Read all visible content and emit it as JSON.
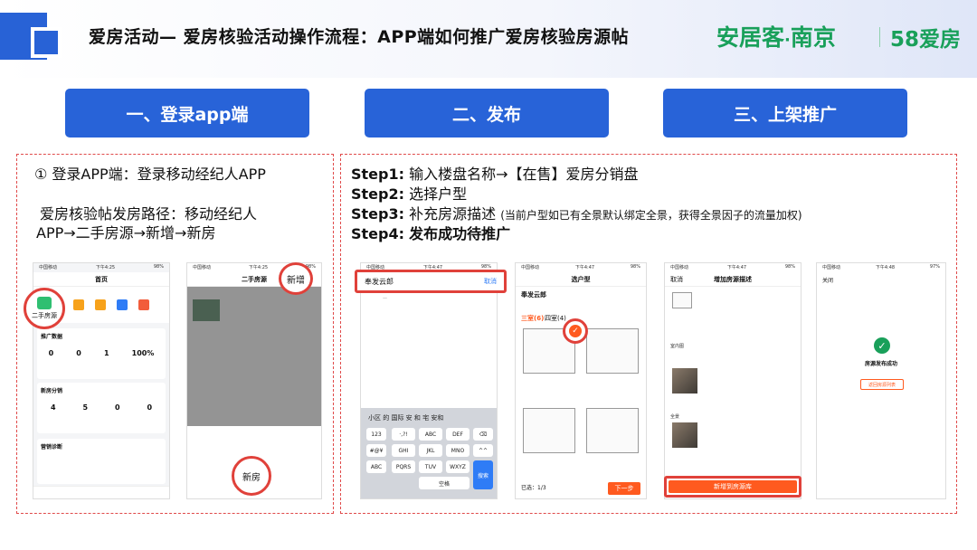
{
  "header": {
    "title": "爱房活动— 爱房核验活动操作流程：APP端如何推广爱房核验房源帖",
    "brand_main": "安居客",
    "brand_city": "南京",
    "brand_58": "58爱房"
  },
  "steps": [
    {
      "label": "一、登录app端"
    },
    {
      "label": "二、发布"
    },
    {
      "label": "三、上架推广"
    }
  ],
  "left_panel": {
    "line1": "① 登录APP端：登录移动经纪人APP",
    "line2": "爱房核验帖发房路径：移动经纪人",
    "line3": "APP→二手房源→新增→新房"
  },
  "right_panel": {
    "step1_label": "Step1:",
    "step1_text": "输入楼盘名称→【在售】爱房分销盘",
    "step2_label": "Step2:",
    "step2_text": "选择户型",
    "step3_label": "Step3:",
    "step3_text": "补充房源描述",
    "step3_note": "(当前户型如已有全景默认绑定全景，获得全景因子的流量加权)",
    "step4_label": "Step4:",
    "step4_text": "发布成功待推广"
  },
  "phone1": {
    "title": "首页",
    "circle_label": "二手房源",
    "section1": "推广数据",
    "section1_values": [
      "0",
      "0",
      "1",
      "100%"
    ],
    "section2": "新房分销",
    "section2_values": [
      "4",
      "5",
      "0",
      "0"
    ],
    "section3": "营销诊断"
  },
  "phone2": {
    "title": "二手房源",
    "circle_top": "新增",
    "circle_bottom": "新房"
  },
  "phone3": {
    "search_value": "奉发云郎",
    "cancel": "取消",
    "suggest_row": "小区  的  国际  安  和  宅  安和",
    "keys": [
      "123",
      "·,?!",
      "ABC",
      "DEF",
      "⌫",
      "#@¥",
      "GHI",
      "JKL",
      "MNO",
      "^^",
      "ABC",
      "PQRS",
      "TUV",
      "WXYZ",
      "搜索",
      "空格"
    ]
  },
  "phone4": {
    "title": "选户型",
    "name": "奉发云郎",
    "tab_active": "三室(6)",
    "tab_other": "四室(4)",
    "footer_count": "已选：1/3",
    "next": "下一步"
  },
  "phone5": {
    "cancel": "取消",
    "title": "增加房源描述",
    "section_images": "室内图",
    "section_pano": "全景",
    "submit": "新增到房源库"
  },
  "phone6": {
    "close": "关闭",
    "success": "房源发布成功",
    "link": "返回房源列表"
  }
}
